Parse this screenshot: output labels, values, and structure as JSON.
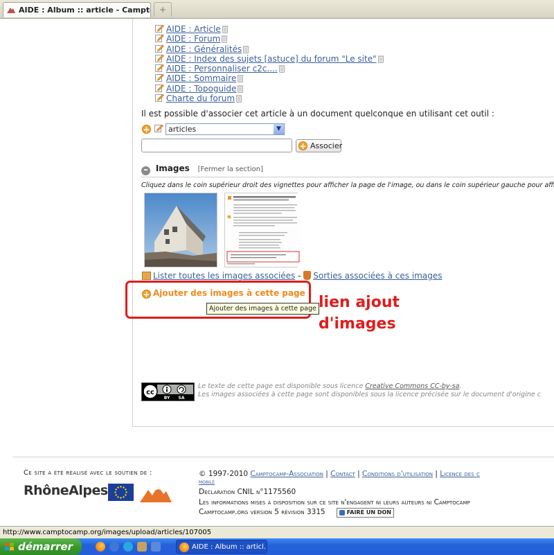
{
  "browser": {
    "tab_title": "AIDE : Album :: article - Camptocamp...",
    "new_tab": "+"
  },
  "aide_links": [
    "AIDE : Article",
    "AIDE : Forum",
    "AIDE : Généralités",
    "AIDE : Index des sujets [astuce] du forum \"Le site\"",
    "AIDE : Personnaliser c2c....",
    "AIDE : Sommaire",
    "AIDE : Topoguide",
    "Charte du forum"
  ],
  "association": {
    "text": "Il est possible d'associer cet article à un document quelconque en utilisant cet outil :",
    "select_value": "articles",
    "input_value": "",
    "button_label": "Associer"
  },
  "images_section": {
    "title": "Images",
    "close_label": "[Fermer la section]",
    "hint": "Cliquez dans le coin supérieur droit des vignettes pour afficher la page de l'image, ou dans le coin supérieur gauche pour afficher l'im",
    "list_link": "Lister toutes les images associées",
    "separator": " - ",
    "outings_link": "Sorties associées à ces images",
    "add_link": "Ajouter des images à cette page",
    "tooltip": "Ajouter des images à cette page"
  },
  "annotation": {
    "line1": "lien ajout",
    "line2": "d'images",
    "color": "#e01c1c"
  },
  "license": {
    "line1_prefix": "Le texte de cette page est disponible sous licence ",
    "line1_link": "Creative Commons CC-by-sa",
    "line1_suffix": ".",
    "line2": "Les images associées à cette page sont disponibles sous la licence précisée sur le document d'origine c",
    "badge_by": "BY",
    "badge_sa": "SA"
  },
  "footer": {
    "support": "Ce site a été réalisé avec le soutien de :",
    "rhonealpes": "RhôneAlpes",
    "copyright": "© 1997-2010 ",
    "assoc_link": "Camptocamp-Association",
    "sep": " | ",
    "contact_link": "Contact",
    "conditions_link": "Conditions d'utilisation",
    "licence_link": "Licence des c",
    "mobile_link": "mobile",
    "cnil": "Déclaration CNIL n°1175560",
    "disclaimer": "Les informations mises à disposition sur ce site n'engagent ni leurs auteurs ni Camptocamp",
    "version": "Camptocamp.org version 5 révision 3315",
    "donate": "FAIRE UN DON"
  },
  "statusbar": {
    "url": "http://www.camptocamp.org/images/upload/articles/107005"
  },
  "taskbar": {
    "start_label": "démarrer",
    "window_label": "AIDE : Album :: articl..."
  },
  "icons": [
    "page-edit-icon",
    "trash-icon",
    "plus-icon",
    "minus-icon",
    "folder-icon",
    "outing-icon",
    "firefox-icon",
    "windows-flag-icon"
  ],
  "colors": {
    "link": "#3a5f9a",
    "orange": "#f08a1c",
    "highlight": "#e01c1c"
  }
}
